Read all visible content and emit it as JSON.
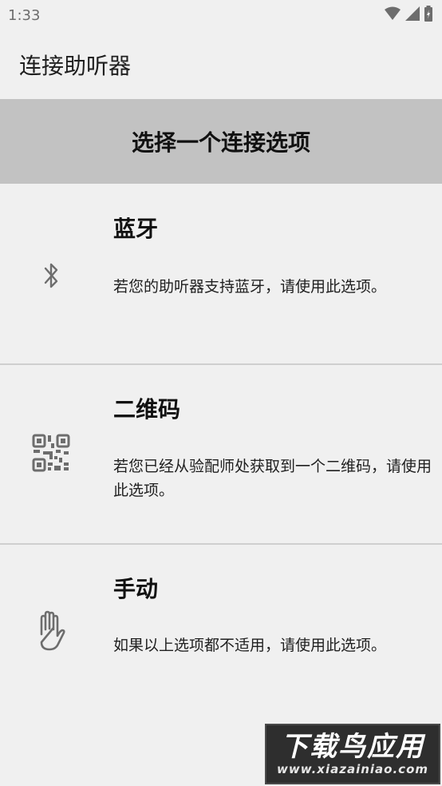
{
  "status_bar": {
    "time": "1:33",
    "icons": [
      "wifi-icon",
      "cell-signal-icon",
      "battery-charging-icon"
    ]
  },
  "app_bar": {
    "title": "连接助听器"
  },
  "section": {
    "header": "选择一个连接选项"
  },
  "options": [
    {
      "icon": "bluetooth-icon",
      "title": "蓝牙",
      "description": "若您的助听器支持蓝牙，请使用此选项。"
    },
    {
      "icon": "qr-code-icon",
      "title": "二维码",
      "description": "若您已经从验配师处获取到一个二维码，请使用此选项。"
    },
    {
      "icon": "hand-icon",
      "title": "手动",
      "description": "如果以上选项都不适用，请使用此选项。"
    }
  ],
  "watermark": {
    "title": "下载鸟应用",
    "url": "www.xiazainiao.com"
  },
  "colors": {
    "background": "#f0f0f0",
    "header_bg": "#c2c2c2",
    "divider": "#cfcfcf",
    "icon": "#6d6d6d"
  }
}
